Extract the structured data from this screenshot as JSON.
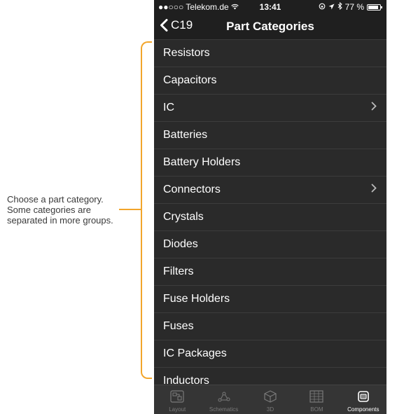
{
  "annotation": {
    "lines": [
      "Choose a part category.",
      "Some categories are",
      "separated in more groups."
    ]
  },
  "status_bar": {
    "carrier": "●●○○○ Telekom.de",
    "time": "13:41",
    "battery": "77 %"
  },
  "nav": {
    "back_label": "C19",
    "title": "Part Categories"
  },
  "categories": [
    {
      "label": "Resistors",
      "has_children": false
    },
    {
      "label": "Capacitors",
      "has_children": false
    },
    {
      "label": "IC",
      "has_children": true
    },
    {
      "label": "Batteries",
      "has_children": false
    },
    {
      "label": "Battery Holders",
      "has_children": false
    },
    {
      "label": "Connectors",
      "has_children": true
    },
    {
      "label": "Crystals",
      "has_children": false
    },
    {
      "label": "Diodes",
      "has_children": false
    },
    {
      "label": "Filters",
      "has_children": false
    },
    {
      "label": "Fuse Holders",
      "has_children": false
    },
    {
      "label": "Fuses",
      "has_children": false
    },
    {
      "label": "IC Packages",
      "has_children": false
    },
    {
      "label": "Inductors",
      "has_children": false
    }
  ],
  "tabs": [
    {
      "label": "Layout",
      "icon": "layout-icon",
      "active": false
    },
    {
      "label": "Schematics",
      "icon": "schematics-icon",
      "active": false
    },
    {
      "label": "3D",
      "icon": "cube-icon",
      "active": false
    },
    {
      "label": "BOM",
      "icon": "grid-icon",
      "active": false
    },
    {
      "label": "Components",
      "icon": "chip-icon",
      "active": true
    }
  ]
}
